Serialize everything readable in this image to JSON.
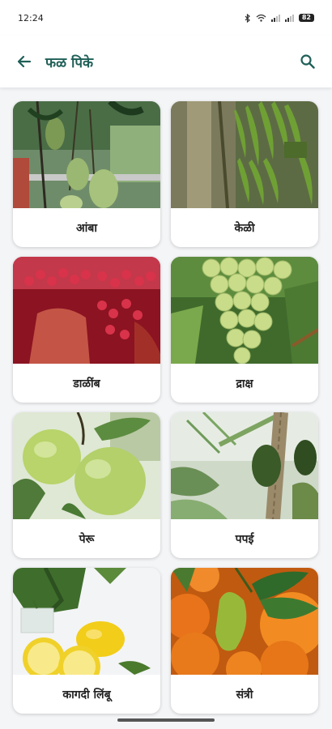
{
  "status_bar": {
    "time": "12:24",
    "battery": "82"
  },
  "app_bar": {
    "title": "फळ पिके",
    "back_icon": "arrow-left-icon",
    "search_icon": "search-icon"
  },
  "crops": [
    {
      "name": "आंबा"
    },
    {
      "name": "केळी"
    },
    {
      "name": "डाळींब"
    },
    {
      "name": "द्राक्ष"
    },
    {
      "name": "पेरू"
    },
    {
      "name": "पपई"
    },
    {
      "name": "कागदी लिंबू"
    },
    {
      "name": "संत्री"
    }
  ],
  "colors": {
    "accent": "#1f5f57",
    "background": "#f4f5f7"
  }
}
